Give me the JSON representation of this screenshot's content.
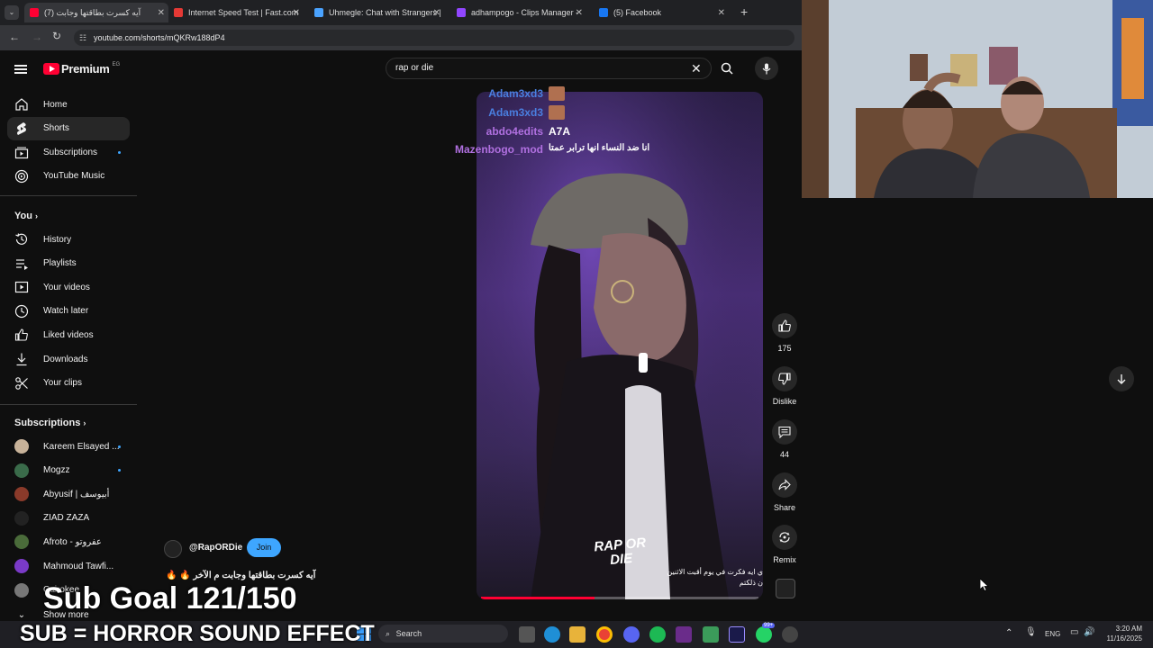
{
  "browser": {
    "tabs": [
      {
        "title": "آيه كسرت بطاقتها وجابت (7)",
        "active": true,
        "color": "#ff0033"
      },
      {
        "title": "Internet Speed Test | Fast.com",
        "color": "#e53935"
      },
      {
        "title": "Uhmegle: Chat with Strangers |",
        "color": "#4aa3ff"
      },
      {
        "title": "adhampogo - Clips Manager -",
        "color": "#9146ff"
      },
      {
        "title": "(5) Facebook",
        "color": "#1877f2"
      }
    ],
    "url": "youtube.com/shorts/mQKRw188dP4"
  },
  "youtube": {
    "logo_text": "Premium",
    "region": "EG",
    "search_value": "rap or die",
    "nav": [
      {
        "label": "Home",
        "icon": "home-icon"
      },
      {
        "label": "Shorts",
        "icon": "shorts-icon"
      },
      {
        "label": "Subscriptions",
        "icon": "subscriptions-icon"
      },
      {
        "label": "YouTube Music",
        "icon": "youtube-music-icon"
      }
    ],
    "you_section": "You",
    "you_items": [
      {
        "label": "History",
        "icon": "history-icon"
      },
      {
        "label": "Playlists",
        "icon": "playlists-icon"
      },
      {
        "label": "Your videos",
        "icon": "your-videos-icon"
      },
      {
        "label": "Watch later",
        "icon": "watch-later-icon"
      },
      {
        "label": "Liked videos",
        "icon": "liked-videos-icon"
      },
      {
        "label": "Downloads",
        "icon": "downloads-icon"
      },
      {
        "label": "Your clips",
        "icon": "scissors-icon"
      }
    ],
    "subs_section": "Subscriptions",
    "subscriptions": [
      {
        "label": "Kareem Elsayed ...",
        "color": "#c7b299"
      },
      {
        "label": "Mogzz",
        "color": "#3a6b4a"
      },
      {
        "label": "Abyusif | أبيوسف",
        "color": "#8a3a2a"
      },
      {
        "label": "ZIAD ZAZA",
        "color": "#222"
      },
      {
        "label": "Afroto - عفروتو",
        "color": "#4a6b3a"
      },
      {
        "label": "Mahmoud Tawfi...",
        "color": "#7a3ac7"
      },
      {
        "label": "Cairokee",
        "color": "#777"
      }
    ],
    "show_more": "Show more",
    "actions": {
      "likes": "175",
      "dislike": "Dislike",
      "comments": "44",
      "share": "Share",
      "remix": "Remix"
    },
    "channel": "@RapORDie",
    "join": "Join",
    "caption": "آيه كسرت بطاقتها وجابت م الآخر",
    "video_logo": "RAP OR DIE",
    "video_subtitle": [
      "ي ايه فكرت في يوم أقبت الاثنين",
      "ن ذلكتم"
    ]
  },
  "chat": [
    {
      "user": "Adam3xd3",
      "msg": "",
      "color": "#4a7fe0"
    },
    {
      "user": "Adam3xd3",
      "msg": "",
      "color": "#4a7fe0"
    },
    {
      "user": "abdo4edits",
      "msg": "A7A",
      "color": "#b070e0"
    },
    {
      "user": "Mazenbogo_mod",
      "msg": "انا ضد النساء انها ترابر عمتا",
      "color": "#b070e0"
    }
  ],
  "overlay": {
    "sub_goal": "Sub Goal 121/150",
    "alert": "SUB = HORROR SOUND EFFECT"
  },
  "taskbar": {
    "search": "Search",
    "lang": "ENG",
    "time": "3:20 AM",
    "date": "11/16/2025",
    "badge": "99+"
  }
}
